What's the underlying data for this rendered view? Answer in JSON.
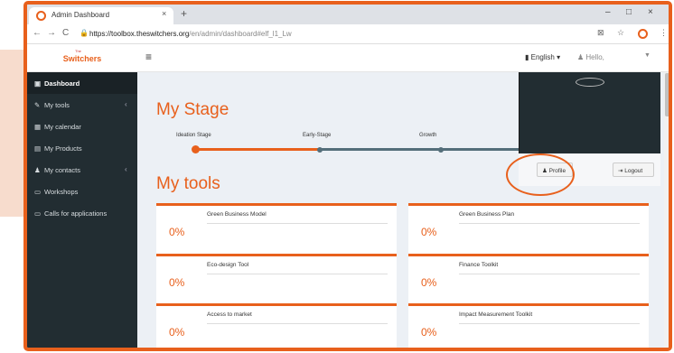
{
  "browser": {
    "tab_title": "Admin Dashboard",
    "tab_close": "×",
    "new_tab": "+",
    "nav_back": "←",
    "nav_forward": "→",
    "nav_reload": "C",
    "url_main": "https://toolbox.theswitchers.org",
    "url_path": "/en/admin/dashboard#elf_l1_Lw",
    "window_min": "–",
    "window_max": "□",
    "window_close": "×",
    "ext_translate": "⊠",
    "ext_star": "☆",
    "ext_menu": "⋮"
  },
  "nav": {
    "logo": "Switchers",
    "logo_small": "The",
    "burger": "≡",
    "language": "English",
    "greeting": "Hello,"
  },
  "sidebar": {
    "items": [
      {
        "label": "Dashboard",
        "icon": "▣"
      },
      {
        "label": "My tools",
        "icon": "✎"
      },
      {
        "label": "My calendar",
        "icon": "▦"
      },
      {
        "label": "My Products",
        "icon": "▤"
      },
      {
        "label": "My contacts",
        "icon": "♟"
      },
      {
        "label": "Workshops",
        "icon": "▭"
      },
      {
        "label": "Calls for applications",
        "icon": "▭"
      }
    ],
    "chevron": "‹"
  },
  "main": {
    "stage_heading": "My Stage",
    "stages": [
      "Ideation Stage",
      "Early-Stage",
      "Growth"
    ],
    "tools_heading": "My tools",
    "tools": [
      {
        "name": "Green Business Model",
        "percent": "0%"
      },
      {
        "name": "Green Business Plan",
        "percent": "0%"
      },
      {
        "name": "Eco-design Tool",
        "percent": "0%"
      },
      {
        "name": "Finance Toolkit",
        "percent": "0%"
      },
      {
        "name": "Access to market",
        "percent": "0%"
      },
      {
        "name": "Impact Measurement Toolkit",
        "percent": "0%"
      }
    ]
  },
  "profile": {
    "profile_button": "Profile",
    "logout_button": "Logout"
  },
  "colors": {
    "accent": "#e8601c",
    "sidebar": "#222d32",
    "stage_line_done": "#e8601c",
    "stage_line_todo": "#546e7a"
  }
}
